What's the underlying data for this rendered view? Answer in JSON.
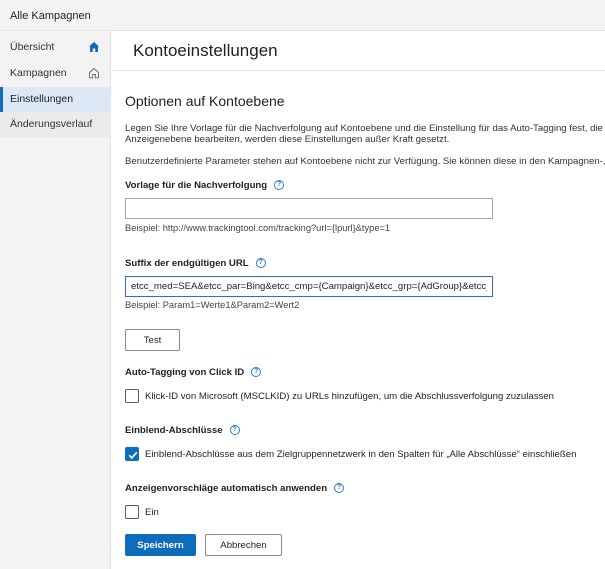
{
  "topbar": {
    "title": "Alle Kampagnen"
  },
  "sidebar": {
    "items": [
      {
        "label": "Übersicht",
        "icon": "home-filled-icon"
      },
      {
        "label": "Kampagnen",
        "icon": "home-outline-icon"
      },
      {
        "label": "Einstellungen",
        "active": true
      },
      {
        "label": "Änderungsverlauf"
      }
    ]
  },
  "page": {
    "title": "Kontoeinstellungen",
    "section_title": "Optionen auf Kontoebene",
    "description_line1": "Legen Sie Ihre Vorlage für die Nachverfolgung auf Kontoebene und die Einstellung für das Auto-Tagging fest, die",
    "description_line2": "Anzeigenebene bearbeiten, werden diese Einstellungen außer Kraft gesetzt.",
    "description_line3": "Benutzerdefinierte Parameter stehen auf Kontoebene nicht zur Verfügung. Sie können diese in den Kampagnen-, A"
  },
  "tracking_template": {
    "label": "Vorlage für die Nachverfolgung",
    "value": "",
    "example": "Beispiel: http://www.trackingtool.com/tracking?url={lpurl}&type=1"
  },
  "final_url_suffix": {
    "label": "Suffix der endgültigen URL",
    "value": "etcc_med=SEA&etcc_par=Bing&etcc_cmp={Campaign}&etcc_grp={AdGroup}&etcc_",
    "example": "Beispiel: Param1=Werte1&Param2=Wert2"
  },
  "test_button": {
    "label": "Test"
  },
  "auto_tagging": {
    "label": "Auto-Tagging von Click ID",
    "checkbox_label": "Klick-ID von Microsoft (MSCLKID) zu URLs hinzufügen, um die Abschlussverfolgung zuzulassen",
    "checked": false
  },
  "view_through": {
    "label": "Einblend-Abschlüsse",
    "checkbox_label": "Einblend-Abschlüsse aus dem Zielgruppennetzwerk in den Spalten für „Alle Abschlüsse“ einschließen",
    "checked": true
  },
  "auto_apply": {
    "label": "Anzeigenvorschläge automatisch anwenden",
    "checkbox_label": "Ein",
    "checked": false
  },
  "footer": {
    "save_label": "Speichern",
    "cancel_label": "Abbrechen"
  },
  "colors": {
    "accent": "#0f6cbd",
    "sidebar_bg": "#f3f3f3",
    "active_bg": "#dde8f6"
  }
}
